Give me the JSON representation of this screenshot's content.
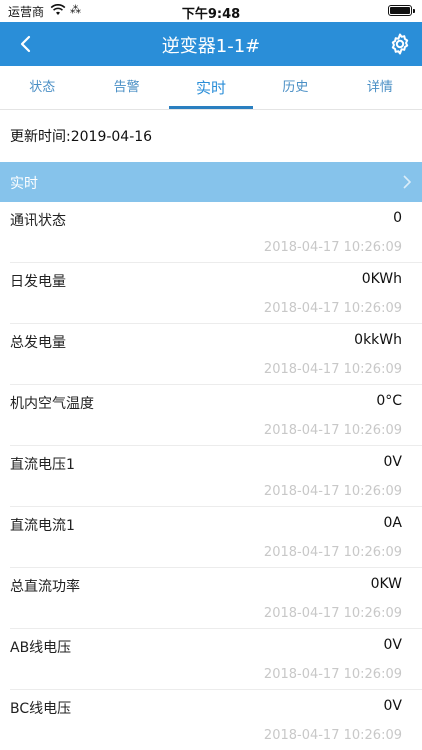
{
  "status_bar": {
    "carrier": "运营商",
    "activity": "⁂",
    "time": "下午9:48",
    "battery_level": 1.0
  },
  "nav": {
    "title": "逆变器1-1#",
    "back_icon": "chevron-left-icon",
    "settings_icon": "gear-icon"
  },
  "tabs": [
    {
      "label": "状态",
      "active": false
    },
    {
      "label": "告警",
      "active": false
    },
    {
      "label": "实时",
      "active": true
    },
    {
      "label": "历史",
      "active": false
    },
    {
      "label": "详情",
      "active": false
    }
  ],
  "updated_label": "更新时间:2019-04-16",
  "section": {
    "label": "实时"
  },
  "rows": [
    {
      "name": "通讯状态",
      "value": "0",
      "timestamp": "2018-04-17 10:26:09"
    },
    {
      "name": "日发电量",
      "value": "0KWh",
      "timestamp": "2018-04-17 10:26:09"
    },
    {
      "name": "总发电量",
      "value": "0kkWh",
      "timestamp": "2018-04-17 10:26:09"
    },
    {
      "name": "机内空气温度",
      "value": "0°C",
      "timestamp": "2018-04-17 10:26:09"
    },
    {
      "name": "直流电压1",
      "value": "0V",
      "timestamp": "2018-04-17 10:26:09"
    },
    {
      "name": "直流电流1",
      "value": "0A",
      "timestamp": "2018-04-17 10:26:09"
    },
    {
      "name": "总直流功率",
      "value": "0KW",
      "timestamp": "2018-04-17 10:26:09"
    },
    {
      "name": "AB线电压",
      "value": "0V",
      "timestamp": "2018-04-17 10:26:09"
    },
    {
      "name": "BC线电压",
      "value": "0V",
      "timestamp": "2018-04-17 10:26:09"
    }
  ],
  "colors": {
    "nav_bg": "#2a8ed8",
    "section_bg": "#86c3eb",
    "tab_text": "#4a8fc5",
    "timestamp": "#c8c8c8"
  }
}
